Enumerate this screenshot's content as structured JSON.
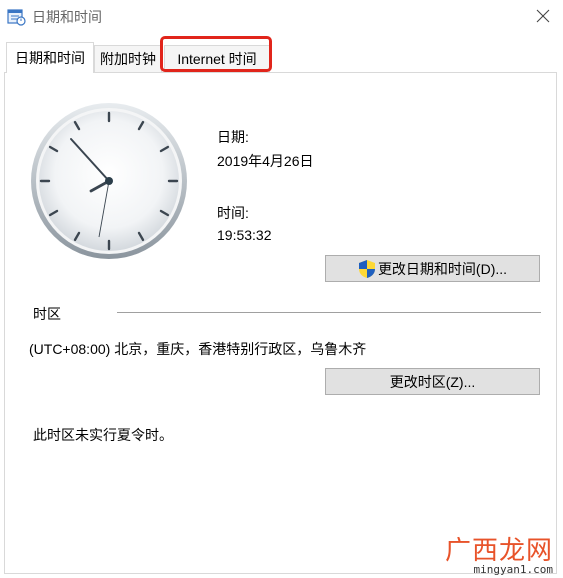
{
  "window": {
    "title": "日期和时间",
    "icon": "calendar-clock-icon",
    "close_icon": "close-icon"
  },
  "tabs": [
    {
      "label": "日期和时间",
      "active": true
    },
    {
      "label": "附加时钟",
      "active": false
    },
    {
      "label": "Internet 时间",
      "active": false,
      "highlighted": true
    }
  ],
  "datetime": {
    "date_label": "日期:",
    "date_value": "2019年4月26日",
    "time_label": "时间:",
    "time_value": "19:53:32",
    "change_button": "更改日期和时间(D)..."
  },
  "timezone": {
    "section_label": "时区",
    "value": "(UTC+08:00) 北京，重庆，香港特别行政区，乌鲁木齐",
    "change_button": "更改时区(Z)...",
    "dst_note": "此时区未实行夏令时。"
  },
  "watermark": {
    "brand": "广西龙网",
    "url": "mingyan1.com"
  },
  "colors": {
    "highlight": "#e1251b",
    "button_bg": "#e1e1e1",
    "watermark": "#e8532a"
  }
}
